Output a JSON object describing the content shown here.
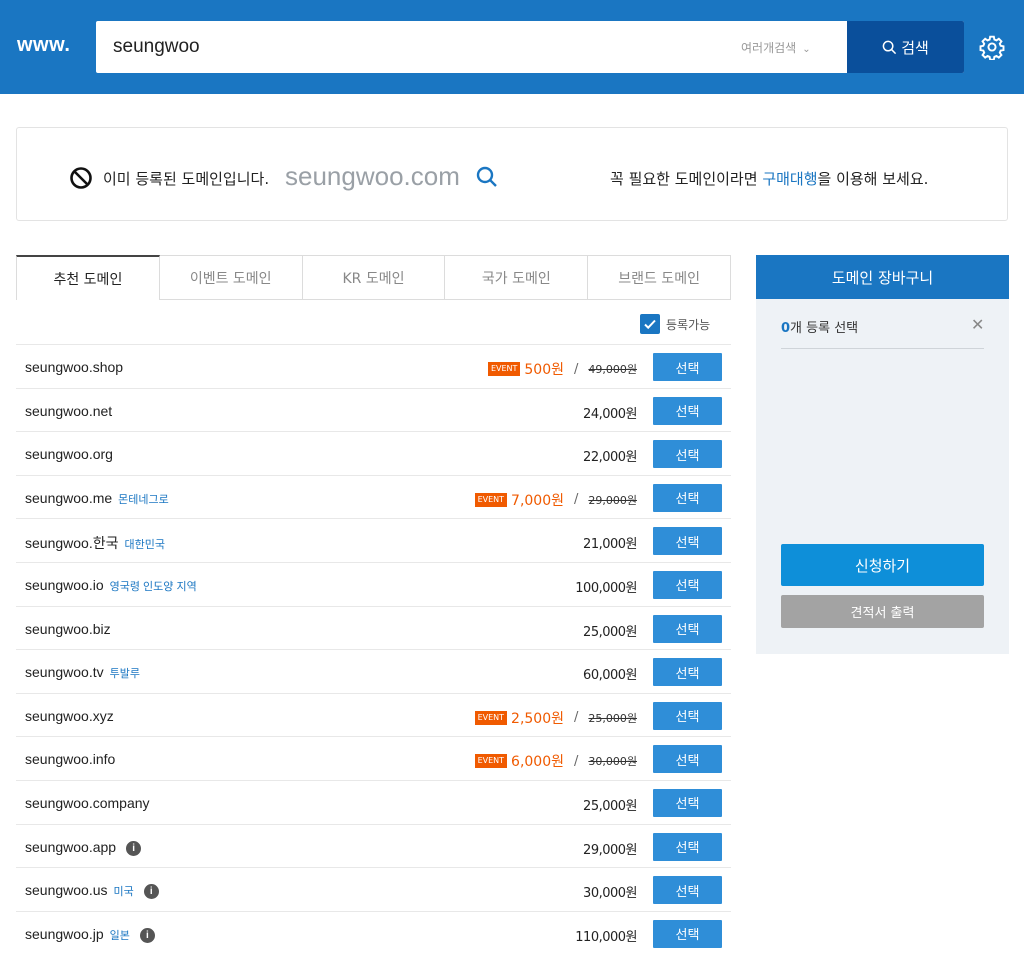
{
  "header": {
    "prefix": "www.",
    "search_value": "seungwoo",
    "multi_search_label": "여러개검색",
    "search_button_label": "검색"
  },
  "notice": {
    "status_text": "이미 등록된 도메인입니다.",
    "domain": "seungwoo.com",
    "right_text_pre": "꼭 필요한 도메인이라면 ",
    "right_link": "구매대행",
    "right_text_post": "을 이용해 보세요."
  },
  "tabs": [
    {
      "label": "추천 도메인",
      "active": true
    },
    {
      "label": "이벤트 도메인",
      "active": false
    },
    {
      "label": "KR 도메인",
      "active": false
    },
    {
      "label": "국가 도메인",
      "active": false
    },
    {
      "label": "브랜드 도메인",
      "active": false
    }
  ],
  "filter": {
    "available_label": "등록가능",
    "checked": true
  },
  "select_label": "선택",
  "event_badge_label": "EVENT",
  "rows": [
    {
      "domain": "seungwoo.shop",
      "region": "",
      "info": false,
      "event": true,
      "event_price": "500원",
      "orig_price": "49,000원",
      "price": ""
    },
    {
      "domain": "seungwoo.net",
      "region": "",
      "info": false,
      "event": false,
      "price": "24,000원"
    },
    {
      "domain": "seungwoo.org",
      "region": "",
      "info": false,
      "event": false,
      "price": "22,000원"
    },
    {
      "domain": "seungwoo.me",
      "region": "몬테네그로",
      "info": false,
      "event": true,
      "event_price": "7,000원",
      "orig_price": "29,000원",
      "price": ""
    },
    {
      "domain": "seungwoo.한국",
      "region": "대한민국",
      "info": false,
      "event": false,
      "price": "21,000원"
    },
    {
      "domain": "seungwoo.io",
      "region": "영국령 인도양 지역",
      "info": false,
      "event": false,
      "price": "100,000원"
    },
    {
      "domain": "seungwoo.biz",
      "region": "",
      "info": false,
      "event": false,
      "price": "25,000원"
    },
    {
      "domain": "seungwoo.tv",
      "region": "투발루",
      "info": false,
      "event": false,
      "price": "60,000원"
    },
    {
      "domain": "seungwoo.xyz",
      "region": "",
      "info": false,
      "event": true,
      "event_price": "2,500원",
      "orig_price": "25,000원",
      "price": ""
    },
    {
      "domain": "seungwoo.info",
      "region": "",
      "info": false,
      "event": true,
      "event_price": "6,000원",
      "orig_price": "30,000원",
      "price": ""
    },
    {
      "domain": "seungwoo.company",
      "region": "",
      "info": false,
      "event": false,
      "price": "25,000원"
    },
    {
      "domain": "seungwoo.app",
      "region": "",
      "info": true,
      "event": false,
      "price": "29,000원"
    },
    {
      "domain": "seungwoo.us",
      "region": "미국",
      "info": true,
      "event": false,
      "price": "30,000원"
    },
    {
      "domain": "seungwoo.jp",
      "region": "일본",
      "info": true,
      "event": false,
      "price": "110,000원"
    }
  ],
  "cart": {
    "title": "도메인 장바구니",
    "count": "0",
    "count_suffix": "개 등록 선택",
    "apply_label": "신청하기",
    "quote_label": "견적서 출력"
  },
  "colors": {
    "brand": "#1a76c2",
    "search_button": "#0a4f9b",
    "event": "#f05a00",
    "select_button": "#2f8ed8"
  }
}
